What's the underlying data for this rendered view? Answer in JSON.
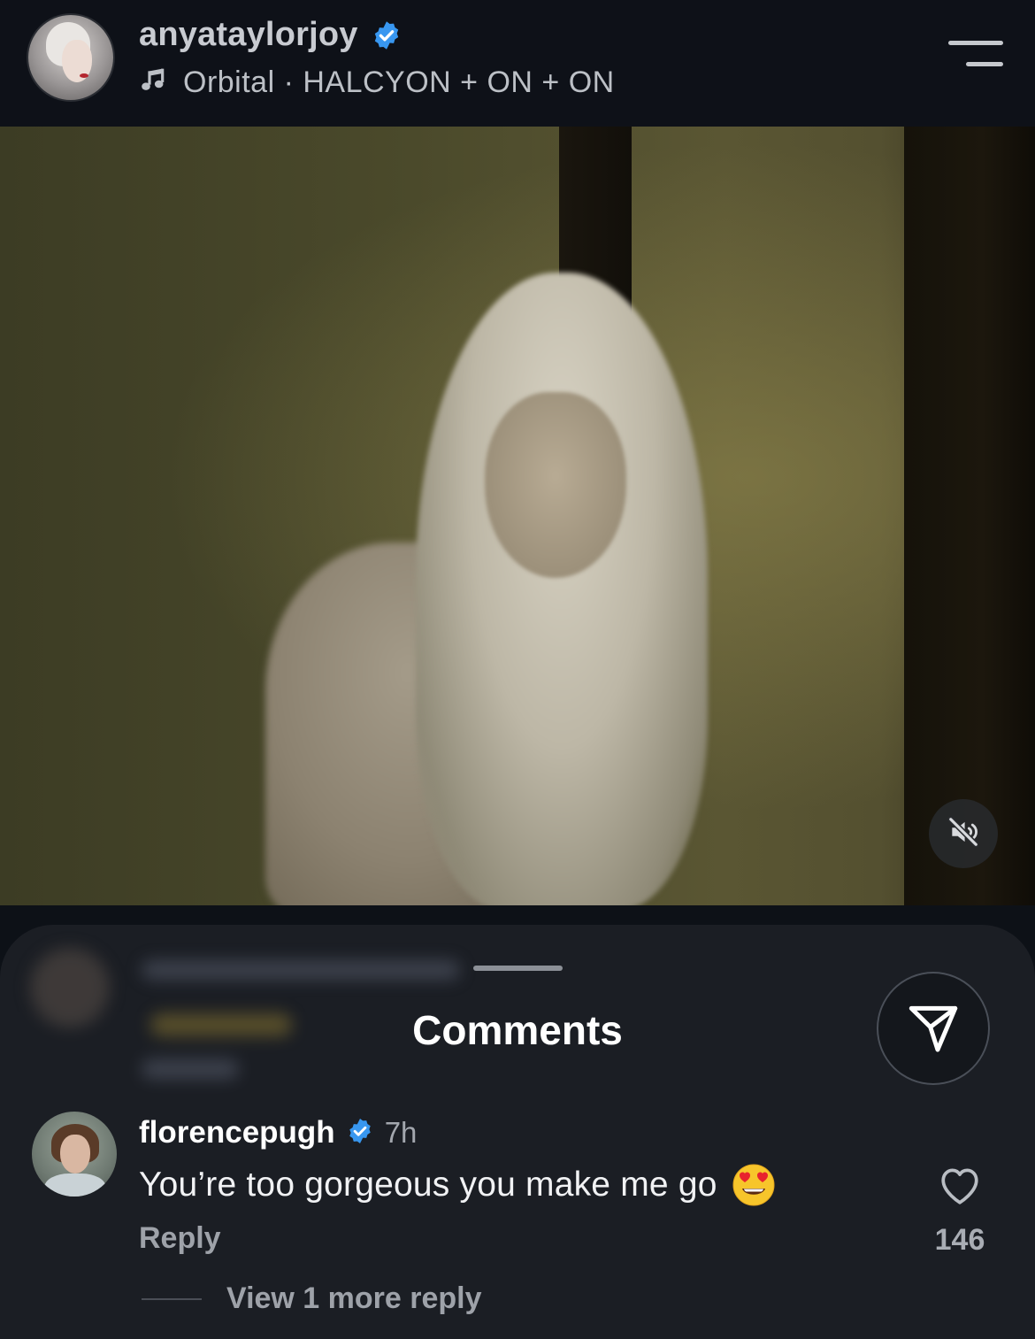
{
  "header": {
    "username": "anyataylorjoy",
    "verified": true,
    "audio_artist": "Orbital",
    "audio_separator": "·",
    "audio_track": "HALCYON + ON + ON",
    "audio_line": "Orbital · HALCYON + ON + ON",
    "icons": {
      "audio": "music-note-icon",
      "menu": "menu-icon",
      "verified": "verified-badge-icon"
    }
  },
  "video": {
    "muted": true,
    "icons": {
      "mute": "speaker-muted-icon"
    }
  },
  "comments_sheet": {
    "title": "Comments",
    "icons": {
      "share": "send-icon"
    },
    "comments": [
      {
        "username": "florencepugh",
        "verified": true,
        "time": "7h",
        "text": "You’re too gorgeous you make me go",
        "emoji": "heart-eyes-emoji",
        "reply_label": "Reply",
        "like_count": "146",
        "view_more_label": "View 1 more reply"
      }
    ]
  },
  "colors": {
    "background": "#0e1118",
    "sheet": "#1b1e24",
    "verified_blue": "#3897f0",
    "secondary_text": "#9ea2a9"
  }
}
